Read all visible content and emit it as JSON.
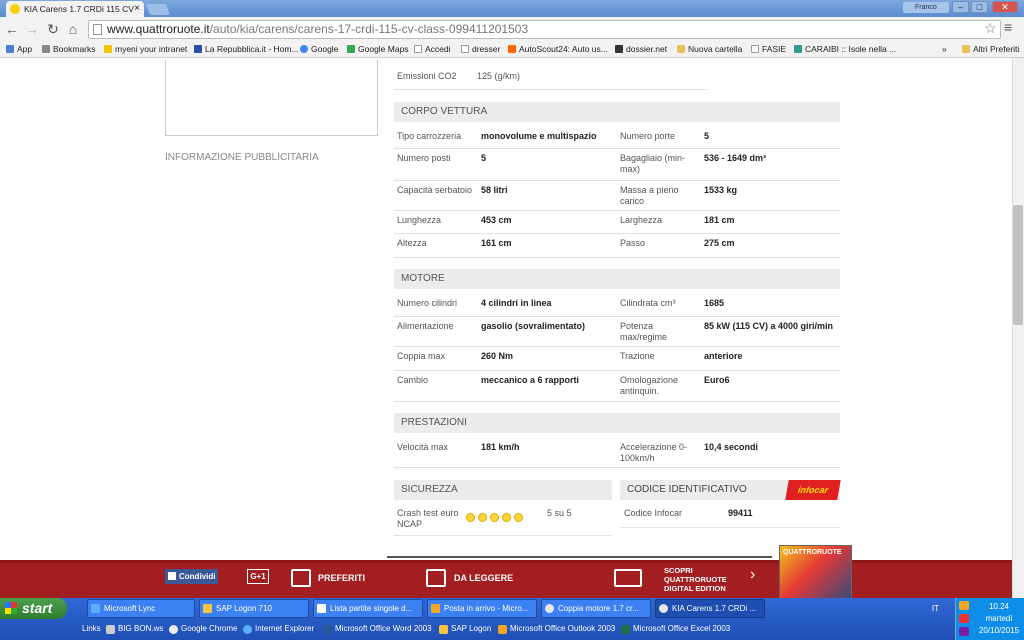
{
  "browser": {
    "tab_title": "KIA Carens 1.7 CRDi 115 CV",
    "tab_close": "×",
    "user": "Franco",
    "url_domain": "www.quattroruote.it",
    "url_path": "/auto/kia/carens/carens-17-crdi-115-cv-class-099411201503",
    "min": "–",
    "max": "□",
    "close": "✕"
  },
  "bookmarks": {
    "items": [
      "App",
      "Bookmarks",
      "myeni your intranet",
      "La Repubblica.it - Hom...",
      "Google",
      "Google Maps",
      "Accedi",
      "dresser",
      "AutoScout24: Auto us...",
      "dossier.net",
      "Nuova cartella",
      "FASIE",
      "CARAIBI :: Isole nella ..."
    ],
    "more": "»",
    "other": "Altri Preferiti"
  },
  "ad": {
    "label": "INFORMAZIONE PUBBLICITARIA"
  },
  "emissions": {
    "label": "Emissioni CO2",
    "value": "125 (g/km)"
  },
  "corpo": {
    "title": "CORPO VETTURA",
    "rows": [
      {
        "l1": "Tipo carrozzeria",
        "v1": "monovolume e multispazio",
        "l2": "Numero porte",
        "v2": "5"
      },
      {
        "l1": "Numero posti",
        "v1": "5",
        "l2": "Bagagliaio (min-max)",
        "v2": "536 - 1649 dm³"
      },
      {
        "l1": "Capacità serbatoio",
        "v1": "58 litri",
        "l2": "Massa a pieno carico",
        "v2": "1533 kg"
      },
      {
        "l1": "Lunghezza",
        "v1": "453 cm",
        "l2": "Larghezza",
        "v2": "181 cm"
      },
      {
        "l1": "Altezza",
        "v1": "161 cm",
        "l2": "Passo",
        "v2": "275 cm"
      }
    ]
  },
  "motore": {
    "title": "MOTORE",
    "rows": [
      {
        "l1": "Numero cilindri",
        "v1": "4 cilindri in linea",
        "l2": "Cilindrata cm³",
        "v2": "1685"
      },
      {
        "l1": "Alimentazione",
        "v1": "gasolio (sovralimentato)",
        "l2": "Potenza max/regime",
        "v2": "85 kW (115 CV) a 4000 giri/min"
      },
      {
        "l1": "Coppia max",
        "v1": "260 Nm",
        "l2": "Trazione",
        "v2": "anteriore"
      },
      {
        "l1": "Cambio",
        "v1": "meccanico a 6 rapporti",
        "l2": "Omologazione antinquin.",
        "v2": "Euro6"
      }
    ]
  },
  "prestazioni": {
    "title": "PRESTAZIONI",
    "rows": [
      {
        "l1": "Velocità max",
        "v1": "181 km/h",
        "l2": "Accelerazione 0-100km/h",
        "v2": "10,4 secondi"
      }
    ]
  },
  "sicurezza": {
    "title": "SICUREZZA",
    "label": "Crash test euro NCAP",
    "stars": 5,
    "value": "5 su 5"
  },
  "codice": {
    "title": "CODICE IDENTIFICATIVO",
    "label": "Codice Infocar",
    "value": "99411",
    "logo": "infocar"
  },
  "footer": {
    "share": "Condividi",
    "gplus": "G+1",
    "preferiti": "PREFERITI",
    "da_leggere": "DA LEGGERE",
    "promo1": "SCOPRI",
    "promo2": "QUATTRORUOTE",
    "promo3": "DIGITAL EDITION",
    "magazine": "QUATTRORUOTE",
    "colors": {
      "bar": "#a31e21"
    }
  },
  "taskbar": {
    "start": "start",
    "tasks": [
      "Microsoft Lync",
      "SAP Logon 710",
      "Lista partite singole d...",
      "Posta in arrivo - Micro...",
      "Coppia motore 1.7 cr...",
      "KIA Carens 1.7 CRDi ..."
    ],
    "quick_links": [
      "Links",
      "BIG BON.ws",
      "Google Chrome",
      "Internet Explorer",
      "Microsoft Office Word 2003",
      "SAP Logon",
      "Microsoft Office Outlook 2003",
      "Microsoft Office Excel 2003"
    ],
    "lang": "IT",
    "time": "10.24",
    "day": "martedì",
    "date": "20/10/2015"
  }
}
